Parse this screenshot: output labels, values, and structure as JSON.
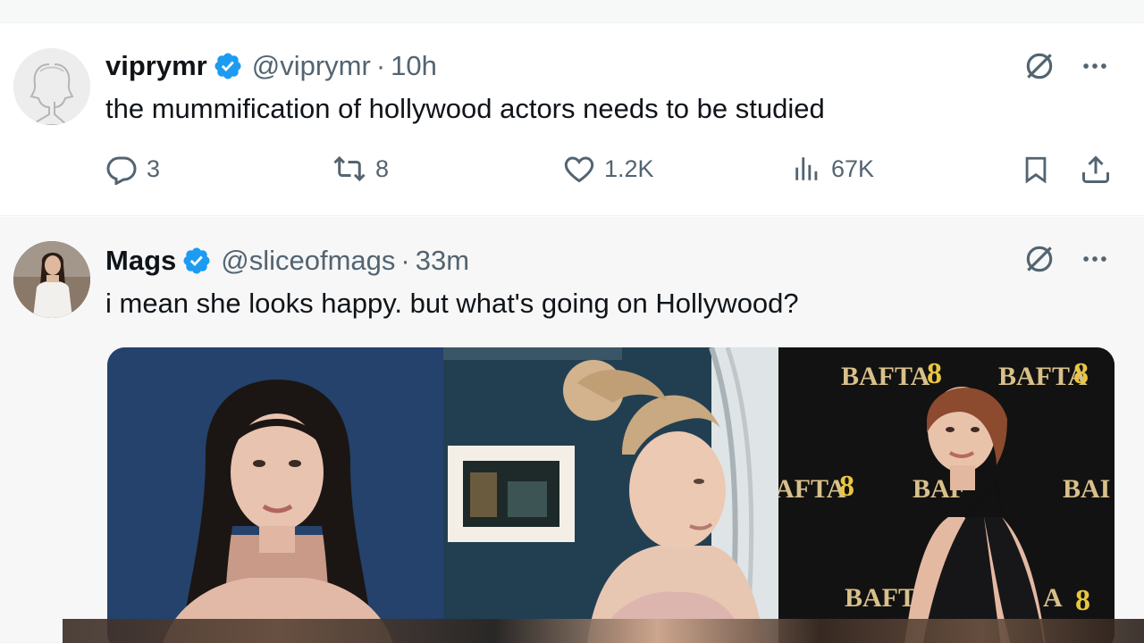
{
  "colors": {
    "verified": "#1d9bf0",
    "secondary_text": "#536471",
    "primary_text": "#0f1419"
  },
  "tweets": [
    {
      "display_name": "viprymr",
      "handle": "@viprymr",
      "separator": "·",
      "time": "10h",
      "text": "the mummification of hollywood actors needs to be studied",
      "stats": {
        "replies": "3",
        "retweets": "8",
        "likes": "1.2K",
        "views": "67K"
      },
      "icons": [
        "grok-icon",
        "more-icon",
        "reply-icon",
        "retweet-icon",
        "like-icon",
        "views-icon",
        "bookmark-icon",
        "share-icon"
      ]
    },
    {
      "display_name": "Mags",
      "handle": "@sliceofmags",
      "separator": "·",
      "time": "33m",
      "text": "i mean she looks happy. but what's going on Hollywood?",
      "media": {
        "photos": [
          {
            "name": "photo-1"
          },
          {
            "name": "photo-2"
          },
          {
            "name": "photo-3",
            "backdrop_text": [
              "BAFTA",
              "8",
              "BAFTA",
              "8",
              "AFTA",
              "8",
              "BAF",
              "BAI",
              "BAFTA",
              "A",
              "8"
            ]
          }
        ]
      }
    }
  ]
}
